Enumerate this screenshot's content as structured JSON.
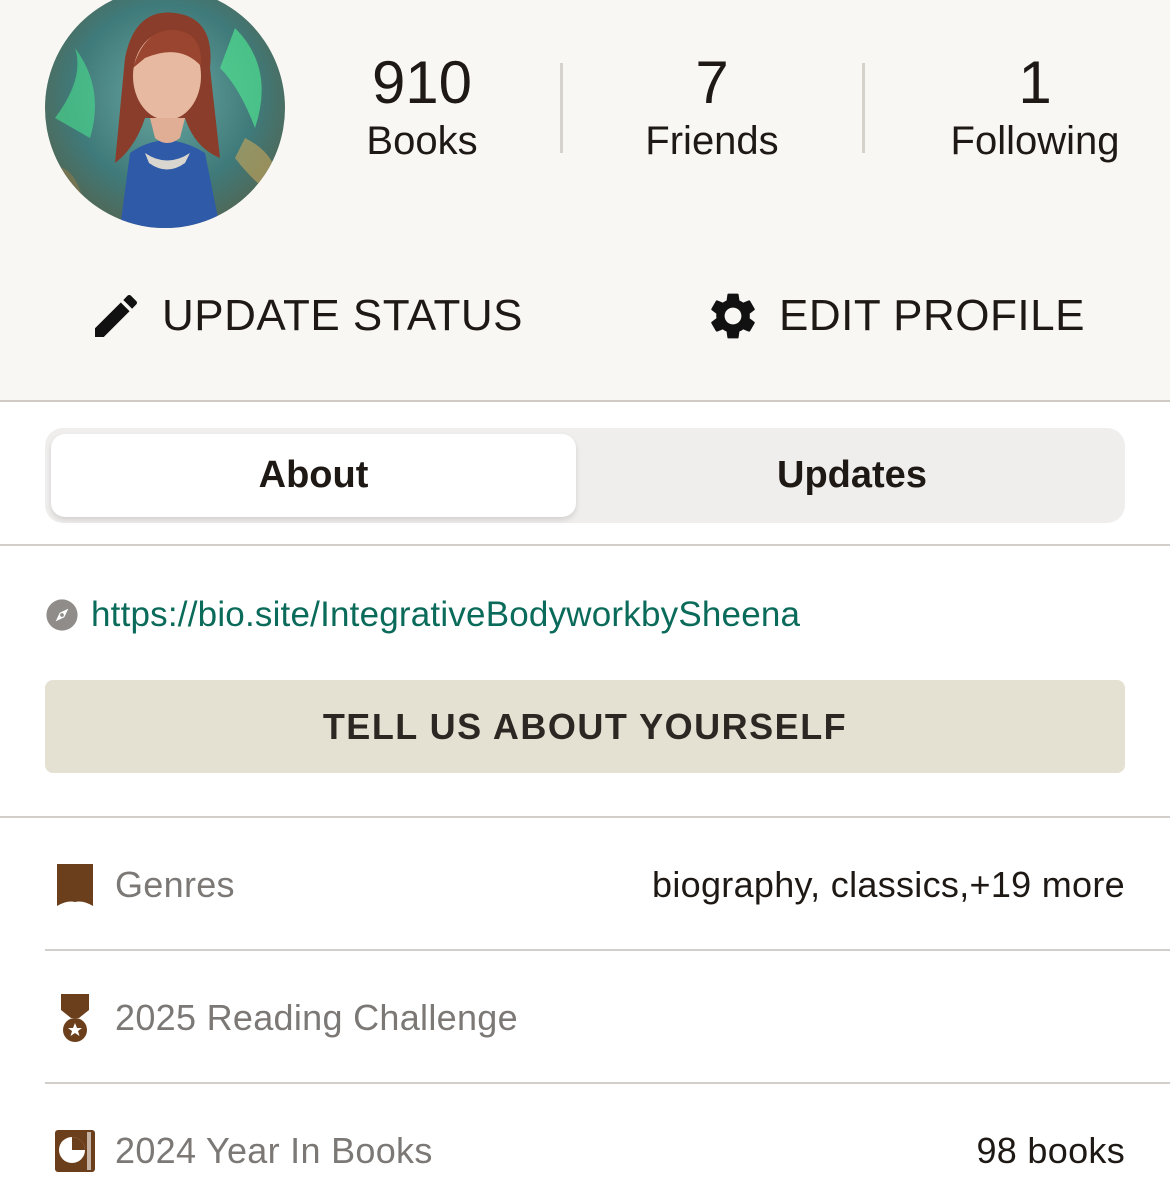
{
  "profile": {
    "stats": [
      {
        "value": "910",
        "label": "Books"
      },
      {
        "value": "7",
        "label": "Friends"
      },
      {
        "value": "1",
        "label": "Following"
      }
    ],
    "actions": {
      "update_status": "UPDATE STATUS",
      "edit_profile": "EDIT PROFILE"
    }
  },
  "tabs": {
    "about": "About",
    "updates": "Updates",
    "selected": "About"
  },
  "about": {
    "website": "https://bio.site/IntegrativeBodyworkbySheena",
    "tell_us_button": "TELL US ABOUT YOURSELF",
    "rows": [
      {
        "label": "Genres",
        "value": "biography, classics,+19 more",
        "icon": "bookmark-icon"
      },
      {
        "label": "2025 Reading Challenge",
        "value": "",
        "icon": "medal-icon"
      },
      {
        "label": "2024 Year In Books",
        "value": "98 books",
        "icon": "year-in-books-icon"
      }
    ]
  },
  "colors": {
    "header_bg": "#f9f7f4",
    "link": "#0b6b5a",
    "button_bg": "#e4e1d2",
    "icon_brown": "#6b3f1c"
  }
}
